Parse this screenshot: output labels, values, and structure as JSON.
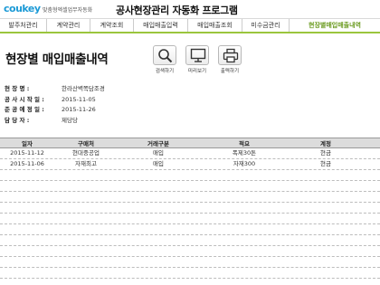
{
  "header": {
    "logo": "coukey",
    "logo_sub": "맞춤형엑셀업무자동화",
    "title": "공사현장관리 자동화 프로그램"
  },
  "nav": [
    {
      "label": "발주처관리",
      "active": false
    },
    {
      "label": "계약관리",
      "active": false
    },
    {
      "label": "계약조회",
      "active": false
    },
    {
      "label": "매입매출입력",
      "active": false
    },
    {
      "label": "매입매출조회",
      "active": false
    },
    {
      "label": "미수금관리",
      "active": false
    },
    {
      "label": "현장별매입매출내역",
      "active": true
    }
  ],
  "page_title": "현장별 매입매출내역",
  "toolbar": {
    "search": "검색하기",
    "preview": "미리보기",
    "print": "출력하기"
  },
  "info": [
    {
      "label": "현 장 명 :",
      "value": "한라산벽쪽담조경"
    },
    {
      "label": "공 사 시 작 일 :",
      "value": "2015-11-05"
    },
    {
      "label": "준 공 예 정 일 :",
      "value": "2015-11-26"
    },
    {
      "label": "담 당 자 :",
      "value": "제당당"
    }
  ],
  "table": {
    "headers": [
      "일자",
      "구매처",
      "거래구분",
      "적요",
      "계정"
    ],
    "rows": [
      [
        "2015-11-12",
        "현대중공업",
        "매입",
        "폭제30톤",
        "현금"
      ],
      [
        "2015-11-06",
        "자재최고",
        "매입",
        "자재300",
        "현금"
      ],
      [
        "",
        "",
        "",
        "",
        ""
      ],
      [
        "",
        "",
        "",
        "",
        ""
      ],
      [
        "",
        "",
        "",
        "",
        ""
      ],
      [
        "",
        "",
        "",
        "",
        ""
      ],
      [
        "",
        "",
        "",
        "",
        ""
      ],
      [
        "",
        "",
        "",
        "",
        ""
      ],
      [
        "",
        "",
        "",
        "",
        ""
      ],
      [
        "",
        "",
        "",
        "",
        ""
      ],
      [
        "",
        "",
        "",
        "",
        ""
      ],
      [
        "",
        "",
        "",
        "",
        ""
      ]
    ]
  },
  "colors": {
    "accent": "#9bc53d",
    "logo": "#1c9ad6",
    "header_bg": "#dcdcdc"
  }
}
